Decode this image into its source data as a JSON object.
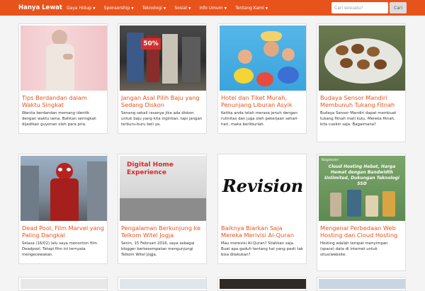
{
  "navbar": {
    "brand": "Hanya Lewat",
    "menu": [
      {
        "label": "Gaya Hidup"
      },
      {
        "label": "Sponsorship"
      },
      {
        "label": "Teknologi"
      },
      {
        "label": "Sosial"
      },
      {
        "label": "Info Umum"
      },
      {
        "label": "Tentang Kami"
      }
    ],
    "search_placeholder": "Cari sesuatu?",
    "search_button": "Cari"
  },
  "posts": [
    {
      "title": "Tips Berdandan dalam Waktu Singkat",
      "excerpt": "Wanita berdandan memang identik dengan waktu lama. Bahkan seringkali dijadikan guyonan oleh para pria."
    },
    {
      "title": "Jangan Asal Pilih Baju yang Sedang Diskon",
      "excerpt": "Senang sekali rasanya jika ada diskon untuk baju yang kita inginkan, tapi jangan terburu-buru beli ya."
    },
    {
      "title": "Hotel dan Tiket Murah, Penunjang Liburan Asyik",
      "excerpt": "Ketika anda telah merasa jenuh dengan rutinitas dan juga oleh pekerjaan sehari-hari, maka berliburlah."
    },
    {
      "title": "Budaya Sensor Mandiri Membunuh Tukang Fitnah",
      "excerpt": "Budaya Sensor Mandiri dapat membuat tukang fitnah mati kutu. Mereka fitnah, kita cuekin saja. Bagaimana?"
    },
    {
      "title": "Dead Pool, Film Marvel yang Paling Dangkal",
      "excerpt": "Selasa (16/02) lalu saya menonton film Deadpool. Tetapi film ini ternyata mengecewakan."
    },
    {
      "title": "Pengalaman Berkunjung ke Telkom Witel Jogja",
      "excerpt": "Senin, 15 Februari 2016, saya sebagai blogger berkesempatan mengunjungi Telkom Witel Jogja."
    },
    {
      "title": "Baiknya Biarkan Saja Mereka Merivisi Al-Quran",
      "excerpt": "Mau merevisi Al-Quran? Silahkan saja. Buat apa gaduh tentang hal yang pasti tak bisa dilakukan?"
    },
    {
      "title": "Mengenal Perbedaan Web Hosting dan Cloud Hosting",
      "excerpt": "Hosting adalah tempat menyimpan (space) data di internet untuk situs/website."
    }
  ],
  "thumbs": {
    "sale_sign": "50%",
    "telkom_sign": "Digital Home Experience",
    "revision_word": "Revision",
    "hosting_banner": "Cloud Hosting Hebat, Harga Hemat dengan Bandwidth Unlimited, Dukungan Teknologi SSD",
    "hosting_brand": "Niagahoster"
  },
  "colors": {
    "accent": "#e8531c",
    "text": "#333333"
  },
  "icons": {
    "caret": "caret-down-icon"
  }
}
